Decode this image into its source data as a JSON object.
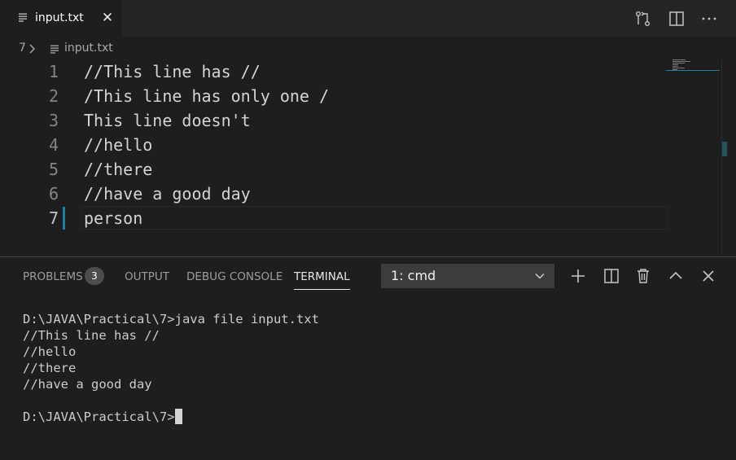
{
  "tab": {
    "label": "input.txt",
    "close_glyph": "✕"
  },
  "tab_actions": [
    "open-changes-icon",
    "split-editor-icon",
    "more-actions-icon"
  ],
  "breadcrumb": {
    "folder": "7",
    "file": "input.txt"
  },
  "editor": {
    "lines": [
      {
        "n": "1",
        "text": "//This line has //"
      },
      {
        "n": "2",
        "text": "/This line has only one /"
      },
      {
        "n": "3",
        "text": "This line doesn't"
      },
      {
        "n": "4",
        "text": "//hello"
      },
      {
        "n": "5",
        "text": "//there"
      },
      {
        "n": "6",
        "text": "//have a good day"
      },
      {
        "n": "7",
        "text": "person"
      }
    ],
    "active_line": "7"
  },
  "panel": {
    "tabs": {
      "problems": "PROBLEMS",
      "output": "OUTPUT",
      "debug": "DEBUG CONSOLE",
      "terminal": "TERMINAL"
    },
    "problems_count": "3",
    "terminal_select": "1: cmd",
    "actions": [
      "plus-icon",
      "split-terminal-icon",
      "trash-icon",
      "chevron-up-icon",
      "close-icon"
    ]
  },
  "terminal": {
    "lines": [
      "D:\\JAVA\\Practical\\7>java file input.txt",
      "//This line has //",
      "//hello",
      "//there",
      "//have a good day",
      "",
      "D:\\JAVA\\Practical\\7>"
    ]
  },
  "colors": {
    "accent": "#1b81a8",
    "background": "#1e1e1e",
    "tabbar": "#252526"
  }
}
